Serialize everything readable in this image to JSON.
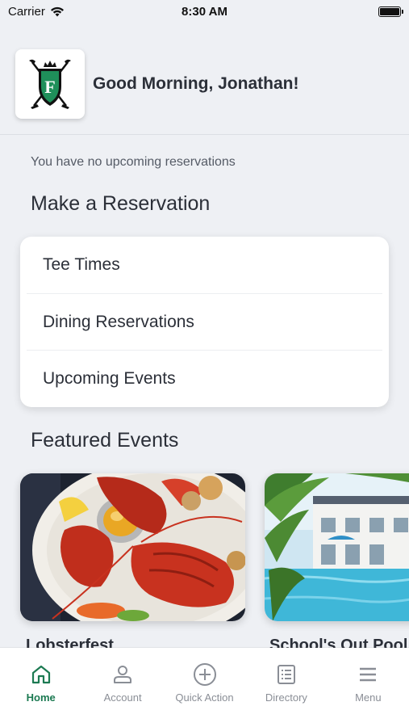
{
  "status_bar": {
    "carrier": "Carrier",
    "time": "8:30 AM"
  },
  "header": {
    "greeting": "Good Morning, Jonathan!",
    "logo_letter": "F"
  },
  "reservations_status": "You have no upcoming reservations",
  "make_reservation": {
    "title": "Make a Reservation",
    "items": [
      {
        "label": "Tee Times"
      },
      {
        "label": "Dining Reservations"
      },
      {
        "label": "Upcoming Events"
      }
    ]
  },
  "featured_events": {
    "title": "Featured Events",
    "events": [
      {
        "title": "Lobsterfest"
      },
      {
        "title": "School's Out Pool"
      }
    ]
  },
  "tab_bar": {
    "tabs": [
      {
        "label": "Home",
        "icon": "home-icon",
        "active": true
      },
      {
        "label": "Account",
        "icon": "person-icon",
        "active": false
      },
      {
        "label": "Quick Action",
        "icon": "plus-circle-icon",
        "active": false
      },
      {
        "label": "Directory",
        "icon": "list-icon",
        "active": false
      },
      {
        "label": "Menu",
        "icon": "hamburger-icon",
        "active": false
      }
    ]
  },
  "colors": {
    "accent": "#1c7a52",
    "background": "#eef0f4",
    "inactive": "#8a8e96"
  }
}
